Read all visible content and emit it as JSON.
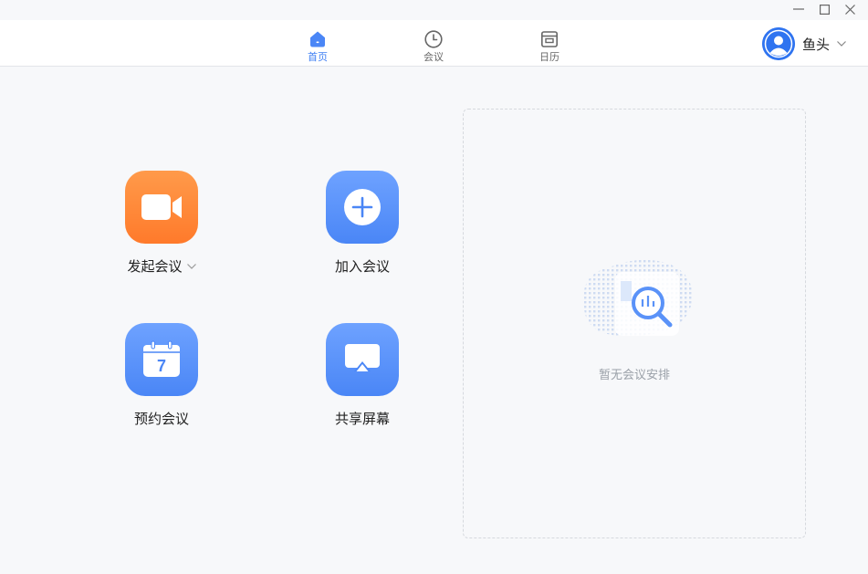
{
  "window_controls": {
    "minimize_icon": "minimize-icon",
    "maximize_icon": "maximize-icon",
    "close_icon": "close-icon"
  },
  "nav": {
    "tabs": [
      {
        "label": "首页",
        "icon": "home-icon",
        "active": true
      },
      {
        "label": "会议",
        "icon": "clock-icon",
        "active": false
      },
      {
        "label": "日历",
        "icon": "calendar-icon",
        "active": false
      }
    ]
  },
  "user": {
    "name": "鱼头",
    "avatar_icon": "user-avatar-icon"
  },
  "actions": [
    {
      "label": "发起会议",
      "icon": "video-camera-icon",
      "has_dropdown": true
    },
    {
      "label": "加入会议",
      "icon": "plus-circle-icon",
      "has_dropdown": false
    },
    {
      "label": "预约会议",
      "icon": "calendar-7-icon",
      "calendar_day": "7",
      "has_dropdown": false
    },
    {
      "label": "共享屏幕",
      "icon": "screen-share-icon",
      "has_dropdown": false
    }
  ],
  "schedule": {
    "empty_text": "暂无会议安排"
  },
  "colors": {
    "accent": "#3f7ff3",
    "orange": "#ff8a3a",
    "blue": "#5a92f8",
    "avatar": "#2f74f0"
  }
}
